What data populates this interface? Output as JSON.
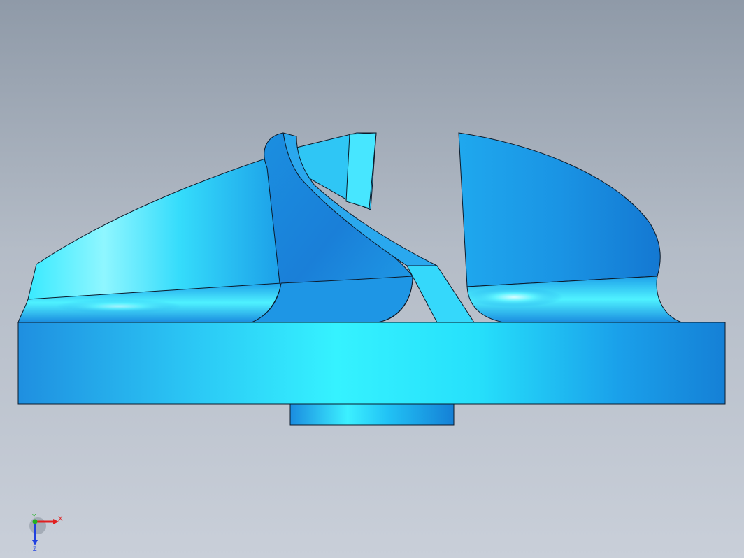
{
  "viewport": {
    "background_top": "#8f9aa8",
    "background_bottom": "#c9cfd9",
    "model_color": "#1aa0ea",
    "model_highlight": "#2ef0ff",
    "edge_color": "#0b1a2a"
  },
  "triad": {
    "x_label": "X",
    "y_label": "Y",
    "z_label": "Z",
    "x_color": "#e02020",
    "y_color": "#20b020",
    "z_color": "#2040e0"
  }
}
